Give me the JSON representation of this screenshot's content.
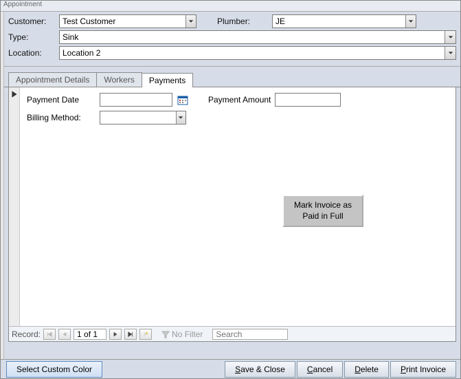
{
  "window": {
    "title": "Appointment"
  },
  "header": {
    "customer_label": "Customer:",
    "customer_value": "Test Customer",
    "plumber_label": "Plumber:",
    "plumber_value": "JE",
    "type_label": "Type:",
    "type_value": "Sink",
    "location_label": "Location:",
    "location_value": "Location 2"
  },
  "tabs": {
    "details": "Appointment Details",
    "workers": "Workers",
    "payments": "Payments"
  },
  "payments": {
    "payment_date_label": "Payment Date",
    "payment_date_value": "",
    "payment_amount_label": "Payment Amount",
    "payment_amount_value": "",
    "billing_method_label": "Billing Method:",
    "billing_method_value": "",
    "mark_paid_button1": "Mark Invoice as",
    "mark_paid_button2": "Paid in Full"
  },
  "nav": {
    "record_label": "Record:",
    "counter": "1 of 1",
    "no_filter": "No Filter",
    "search_placeholder": "Search"
  },
  "footer": {
    "select_color": "Select Custom Color",
    "save_close_pre": "",
    "save_close_u": "S",
    "save_close_post": "ave & Close",
    "cancel_u": "C",
    "cancel_post": "ancel",
    "delete_u": "D",
    "delete_post": "elete",
    "print_u": "P",
    "print_post": "rint Invoice"
  }
}
